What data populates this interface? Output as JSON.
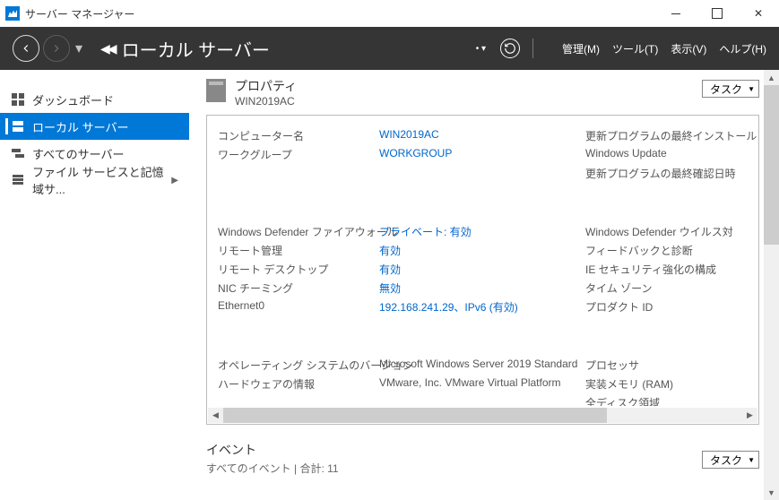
{
  "window": {
    "title": "サーバー マネージャー"
  },
  "ribbon": {
    "breadcrumb": "ローカル サーバー",
    "menu": {
      "manage": "管理(M)",
      "tools": "ツール(T)",
      "view": "表示(V)",
      "help": "ヘルプ(H)"
    }
  },
  "sidebar": {
    "items": [
      {
        "label": "ダッシュボード"
      },
      {
        "label": "ローカル サーバー"
      },
      {
        "label": "すべてのサーバー"
      },
      {
        "label": "ファイル サービスと記憶域サ..."
      }
    ]
  },
  "properties": {
    "title": "プロパティ",
    "subtitle": "WIN2019AC",
    "task_label": "タスク",
    "rows": {
      "computer_name_l": "コンピューター名",
      "computer_name_v": "WIN2019AC",
      "workgroup_l": "ワークグループ",
      "workgroup_v": "WORKGROUP",
      "update_install_l": "更新プログラムの最終インストール",
      "windows_update_l": "Windows Update",
      "update_check_l": "更新プログラムの最終確認日時",
      "firewall_l": "Windows Defender ファイアウォール",
      "firewall_v": "プライベート: 有効",
      "remote_mgmt_l": "リモート管理",
      "remote_mgmt_v": "有効",
      "remote_desktop_l": "リモート デスクトップ",
      "remote_desktop_v": "有効",
      "nic_teaming_l": "NIC チーミング",
      "nic_teaming_v": "無効",
      "ethernet_l": "Ethernet0",
      "ethernet_v": "192.168.241.29、IPv6 (有効)",
      "defender_av_l": "Windows Defender ウイルス対",
      "feedback_l": "フィードバックと診断",
      "ie_sec_l": "IE セキュリティ強化の構成",
      "timezone_l": "タイム ゾーン",
      "product_id_l": "プロダクト ID",
      "os_version_l": "オペレーティング システムのバージョン",
      "os_version_v": "Microsoft Windows Server 2019 Standard",
      "hardware_l": "ハードウェアの情報",
      "hardware_v": "VMware, Inc. VMware Virtual Platform",
      "processor_l": "プロセッサ",
      "memory_l": "実装メモリ (RAM)",
      "disk_l": "全ディスク領域"
    }
  },
  "events": {
    "title": "イベント",
    "subtitle": "すべてのイベント | 合計: 11",
    "task_label": "タスク"
  }
}
